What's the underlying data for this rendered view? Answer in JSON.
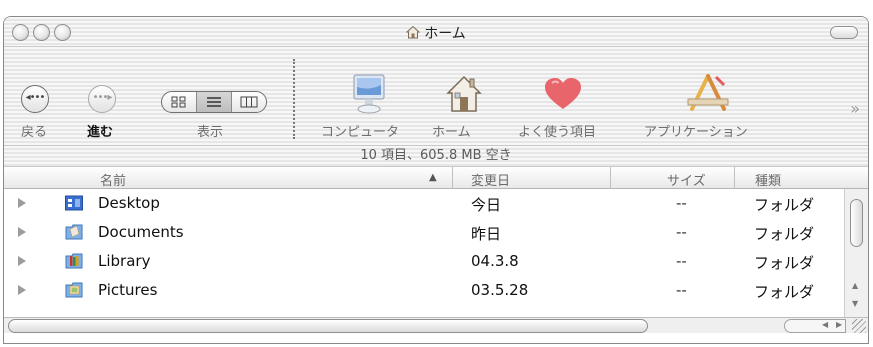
{
  "window": {
    "title": "ホーム"
  },
  "toolbar": {
    "back_label": "戻る",
    "forward_label": "進む",
    "view_label": "表示",
    "computer_label": "コンピュータ",
    "home_label": "ホーム",
    "favorites_label": "よく使う項目",
    "applications_label": "アプリケーション",
    "overflow": "»"
  },
  "status": {
    "text": "10 項目、605.8 MB 空き"
  },
  "columns": {
    "name": "名前",
    "modified": "変更日",
    "size": "サイズ",
    "kind": "種類"
  },
  "rows": [
    {
      "name": "Desktop",
      "date": "今日",
      "size": "--",
      "kind": "フォルダ",
      "icon": "desktop-folder-icon"
    },
    {
      "name": "Documents",
      "date": "昨日",
      "size": "--",
      "kind": "フォルダ",
      "icon": "documents-folder-icon"
    },
    {
      "name": "Library",
      "date": "04.3.8",
      "size": "--",
      "kind": "フォルダ",
      "icon": "library-folder-icon"
    },
    {
      "name": "Pictures",
      "date": "03.5.28",
      "size": "--",
      "kind": "フォルダ",
      "icon": "pictures-folder-icon"
    }
  ],
  "colors": {
    "folder_blue": "#3a6fd0",
    "heart_red": "#e2555a",
    "sort_arrow": "#555555"
  }
}
